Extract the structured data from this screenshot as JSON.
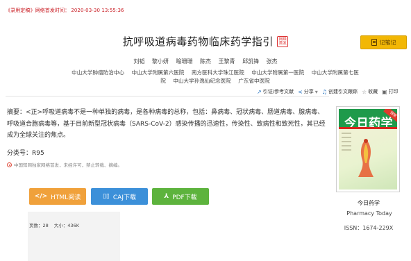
{
  "header": {
    "status_label": "《录用定稿》网络首发时间：",
    "published_time": "2020-03-30 13:55:36"
  },
  "article": {
    "title": "抗呼吸道病毒药物临床药学指引",
    "first_badge": "网络首发",
    "authors": [
      "刘韬",
      "黎小妍",
      "喻珊珊",
      "陈杰",
      "王黎青",
      "邱凯锋",
      "张杰"
    ],
    "organizations_line1": [
      "中山大学肿瘤防治中心",
      "中山大学附属第六医院",
      "南方医科大学珠江医院",
      "中山大学附属第一医院",
      "中山大学附属第七医"
    ],
    "organizations_line2": [
      "院",
      "中山大学孙逸仙纪念医院",
      "广东省中医院"
    ],
    "abstract_label": "摘要：",
    "abstract_text": "<正>呼吸道病毒不是一种单独的病毒，是各种病毒的总称，包括：鼻病毒、冠状病毒、肠道病毒、腺病毒、呼吸道合胞病毒等，基于目前新型冠状病毒（SARS-CoV-2）感染传播的迅速性，传染性、致病性和致死性，其已经成为全球关注的焦点。",
    "clc_label": "分类号：",
    "clc_value": "R95",
    "notice": "中国知网独家网络首发，未经许可，禁止转载、摘编。"
  },
  "toolbar": {
    "cite_label": "引证/参考文献",
    "share_label": "分享",
    "create_citation_label": "创建引文跟踪",
    "favorite_label": "收藏",
    "print_label": "打印",
    "note_label": "记笔记"
  },
  "downloads": {
    "html_label": "HTML阅读",
    "caj_label": "CAJ下载",
    "pdf_label": "PDF下载"
  },
  "file_meta": {
    "pages_label": "页数：28",
    "size_label": "大小：436K"
  },
  "journal": {
    "cover_title": "今日药学",
    "cover_corner": "独家",
    "name_cn": "今日药学",
    "name_en": "Pharmacy Today",
    "issn": "ISSN：1674-229X"
  },
  "colors": {
    "accent_red": "#c8161d",
    "note_yellow": "#f2b705",
    "html_orange": "#f0a13b",
    "caj_blue": "#3c90d9",
    "pdf_green": "#5db33d"
  }
}
